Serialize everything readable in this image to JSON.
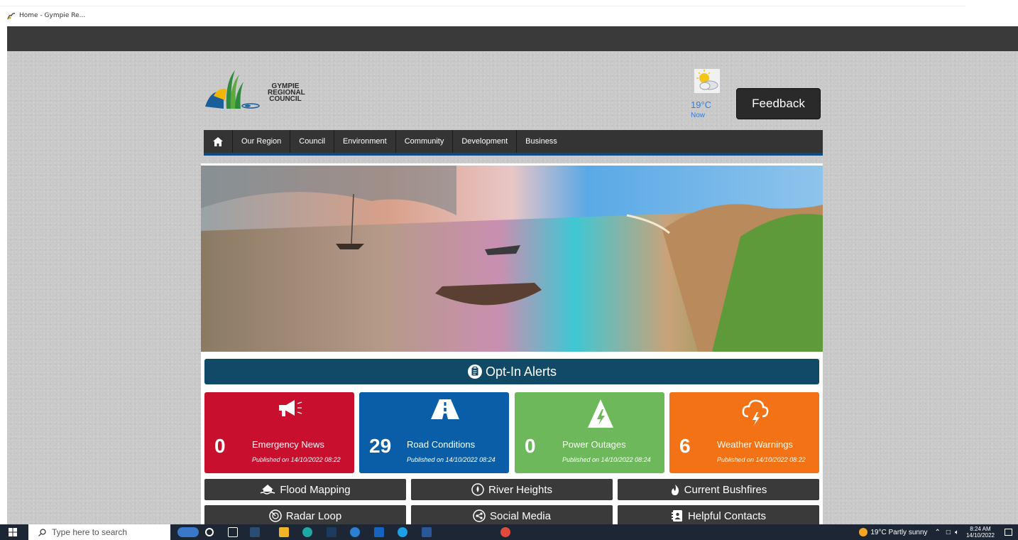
{
  "browser": {
    "tab_title": "Home - Gympie Re..."
  },
  "header": {
    "logo_lines": [
      "GYMPIE",
      "REGIONAL",
      "COUNCIL"
    ],
    "weather": {
      "icon": "partly-sunny-icon",
      "temp": "19°C",
      "label": "Now"
    },
    "feedback_label": "Feedback"
  },
  "nav": {
    "home_icon": "home-icon",
    "items": [
      "Our Region",
      "Council",
      "Environment",
      "Community",
      "Development",
      "Business"
    ]
  },
  "optin": {
    "label": "Opt-In Alerts"
  },
  "alerts": [
    {
      "count": "0",
      "label": "Emergency News",
      "published": "Published on 14/10/2022 08:22",
      "color": "#c8102e",
      "icon": "megaphone-icon"
    },
    {
      "count": "29",
      "label": "Road Conditions",
      "published": "Published on 14/10/2022 08:24",
      "color": "#0a5ea8",
      "icon": "road-icon"
    },
    {
      "count": "0",
      "label": "Power Outages",
      "published": "Published on 14/10/2022 08:24",
      "color": "#6db85a",
      "icon": "power-icon"
    },
    {
      "count": "6",
      "label": "Weather Warnings",
      "published": "Published on 14/10/2022 08:22",
      "color": "#f47216",
      "icon": "storm-icon"
    }
  ],
  "quick_links": [
    {
      "label": "Flood Mapping",
      "icon": "flood-house-icon"
    },
    {
      "label": "River Heights",
      "icon": "gauge-icon"
    },
    {
      "label": "Current Bushfires",
      "icon": "fire-icon"
    },
    {
      "label": "Radar Loop",
      "icon": "radar-icon"
    },
    {
      "label": "Social Media",
      "icon": "share-icon"
    },
    {
      "label": "Helpful Contacts",
      "icon": "contacts-icon"
    }
  ],
  "taskbar": {
    "search_placeholder": "Type here to search",
    "weather": "19°C  Partly sunny",
    "time": "8:24 AM",
    "date": "14/10/2022"
  }
}
